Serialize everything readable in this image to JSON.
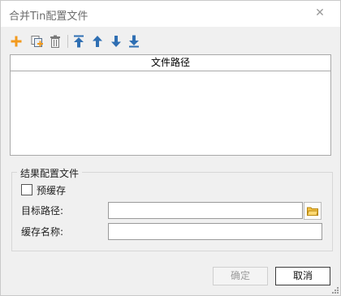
{
  "window": {
    "title": "合并Tin配置文件",
    "close_glyph": "✕"
  },
  "toolbar": {
    "buttons": [
      {
        "name": "add",
        "icon": "plus-icon"
      },
      {
        "name": "add-copy",
        "icon": "add-copy-icon"
      },
      {
        "name": "delete",
        "icon": "trash-icon"
      },
      {
        "name": "move-top",
        "icon": "arrow-to-top-icon"
      },
      {
        "name": "move-up",
        "icon": "arrow-up-icon"
      },
      {
        "name": "move-down",
        "icon": "arrow-down-icon"
      },
      {
        "name": "move-bottom",
        "icon": "arrow-to-bottom-icon"
      }
    ],
    "colors": {
      "add": "#f29a1e",
      "arrows": "#2f6fb3",
      "gray": "#7a7a7a"
    }
  },
  "file_list": {
    "column_header": "文件路径",
    "rows": []
  },
  "result_group": {
    "label": "结果配置文件",
    "precache_label": "预缓存",
    "precache_checked": false,
    "target_path_label": "目标路径:",
    "target_path_value": "",
    "cache_name_label": "缓存名称:",
    "cache_name_value": ""
  },
  "buttons": {
    "ok_label": "确定",
    "ok_enabled": false,
    "cancel_label": "取消"
  }
}
